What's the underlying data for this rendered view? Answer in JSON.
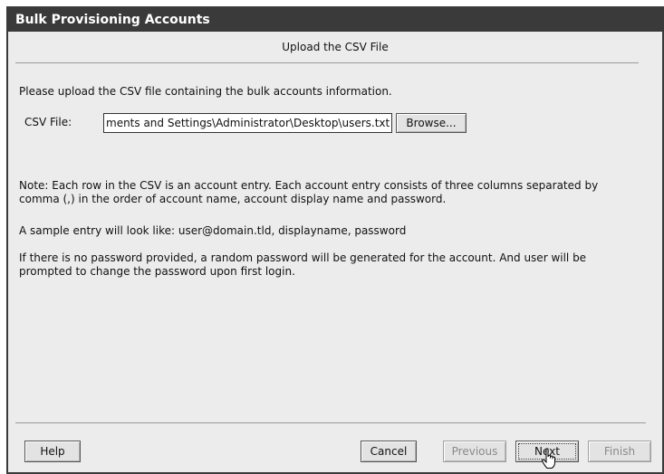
{
  "window": {
    "title": "Bulk Provisioning Accounts"
  },
  "step": {
    "title": "Upload the CSV File"
  },
  "content": {
    "intro": "Please upload the CSV file containing the bulk accounts information.",
    "csv_label": "CSV File:",
    "csv_value": "ments and Settings\\Administrator\\Desktop\\users.txt",
    "browse_label": "Browse...",
    "note1": "Note: Each row in the CSV is an account entry. Each account entry consists of three columns separated by comma (,) in the order of account name, account display name and password.",
    "note2": "A sample entry will look like: user@domain.tld, displayname, password",
    "note3": "If there is no password provided, a random password will be generated for the account. And user will be prompted to change the password upon first login."
  },
  "footer": {
    "help_label": "Help",
    "cancel_label": "Cancel",
    "previous_label": "Previous",
    "next_label": "Next",
    "finish_label": "Finish"
  },
  "colors": {
    "titlebar": "#3a3a3a",
    "dialog_bg": "#ececec"
  },
  "icons": {
    "cursor": "hand-pointer-icon"
  }
}
